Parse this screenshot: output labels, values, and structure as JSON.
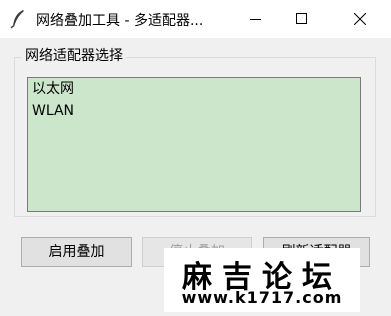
{
  "window": {
    "title": "网络叠加工具 - 多适配器...",
    "icon": "feather-icon"
  },
  "controls": {
    "minimize_icon": "minimize-icon",
    "maximize_icon": "maximize-icon",
    "close_icon": "close-icon"
  },
  "adapter_group": {
    "label": "网络适配器选择",
    "items": [
      "以太网",
      "WLAN"
    ],
    "list_background": "#cce6cc"
  },
  "buttons": {
    "start": "启用叠加",
    "stop": "停止叠加",
    "refresh": "刷新适配器"
  },
  "watermark": {
    "title": "麻吉论坛",
    "url": "www.k1717.com"
  }
}
